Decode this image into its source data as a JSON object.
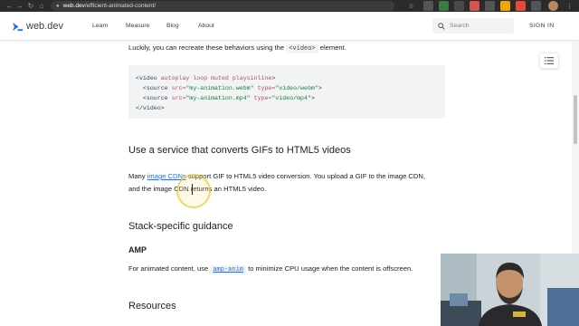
{
  "browser": {
    "url_host": "web.dev",
    "url_path": "/efficient-animated-content/",
    "icons": [
      "back-icon",
      "forward-icon",
      "reload-icon",
      "home-icon",
      "lock-icon",
      "star-icon",
      "extension-icon",
      "profile-icon",
      "menu-icon"
    ]
  },
  "header": {
    "logo_text": "web.dev",
    "nav": [
      "Learn",
      "Measure",
      "Blog",
      "About"
    ],
    "search_placeholder": "Search",
    "signin_label": "SIGN IN"
  },
  "article": {
    "intro_text_before": "Luckily, you can recreate these behaviors using the",
    "intro_code": "<video>",
    "intro_text_after": "element.",
    "code_lines": [
      {
        "parts": [
          [
            "tag",
            "<video "
          ],
          [
            "attr",
            "autoplay loop muted playsinline"
          ],
          [
            "tag",
            ">"
          ]
        ]
      },
      {
        "parts": [
          [
            "tag",
            "  <source "
          ],
          [
            "attr",
            "src="
          ],
          [
            "str",
            "\"my-animation.webm\""
          ],
          [
            "tag",
            " "
          ],
          [
            "attr",
            "type="
          ],
          [
            "str",
            "\"video/webm\""
          ],
          [
            "tag",
            ">"
          ]
        ]
      },
      {
        "parts": [
          [
            "tag",
            "  <source "
          ],
          [
            "attr",
            "src="
          ],
          [
            "str",
            "\"my-animation.mp4\""
          ],
          [
            "tag",
            " "
          ],
          [
            "attr",
            "type="
          ],
          [
            "str",
            "\"video/mp4\""
          ],
          [
            "tag",
            ">"
          ]
        ]
      },
      {
        "parts": [
          [
            "tag",
            "</video>"
          ]
        ]
      }
    ],
    "h2_service": "Use a service that converts GIFs to HTML5 videos",
    "service_text_1": "Many",
    "service_link": "image CDNs",
    "service_text_2": "support GIF to HTML5 video conversion. You upload a GIF to the image CDN,",
    "service_line2": "and the image CDN returns an HTML5 video.",
    "h2_stack": "Stack-specific guidance",
    "h3_amp": "AMP",
    "amp_text_before": "For animated content, use",
    "amp_code": "amp-anim",
    "amp_text_after": "to minimize CPU usage when the content is offscreen.",
    "h2_resources": "Resources"
  },
  "colors": {
    "link": "#1a73e8",
    "text": "#202124",
    "code_bg": "#f1f3f4",
    "chrome_bg": "#2b2b2b"
  }
}
